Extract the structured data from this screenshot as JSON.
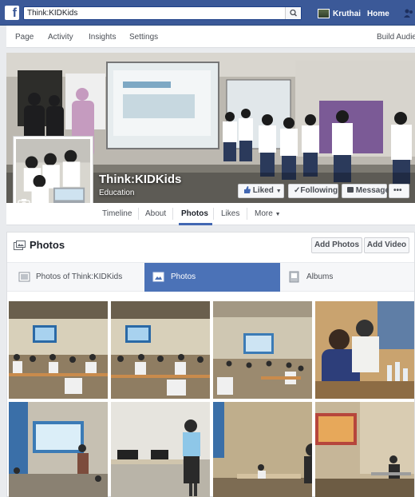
{
  "topbar": {
    "search_value": "Think:KIDKids",
    "user_name": "Kruthai",
    "home": "Home"
  },
  "page_nav": {
    "items": [
      "Page",
      "Activity",
      "Insights",
      "Settings"
    ],
    "right": "Build Audie"
  },
  "page": {
    "name": "Think:KIDKids",
    "category": "Education"
  },
  "cover_buttons": {
    "liked": "Liked",
    "following": "Following",
    "message": "Message",
    "more": "•••"
  },
  "tabs": {
    "timeline": "Timeline",
    "about": "About",
    "photos": "Photos",
    "likes": "Likes",
    "more": "More"
  },
  "photos_section": {
    "title": "Photos",
    "add_photos": "Add Photos",
    "add_video": "Add Video",
    "subtabs": [
      "Photos of Think:KIDKids",
      "Photos",
      "Albums"
    ],
    "active_subtab": "Photos"
  },
  "colors": {
    "brand": "#3b5998",
    "active_tab": "#4b72b7",
    "link": "#4267b2"
  }
}
